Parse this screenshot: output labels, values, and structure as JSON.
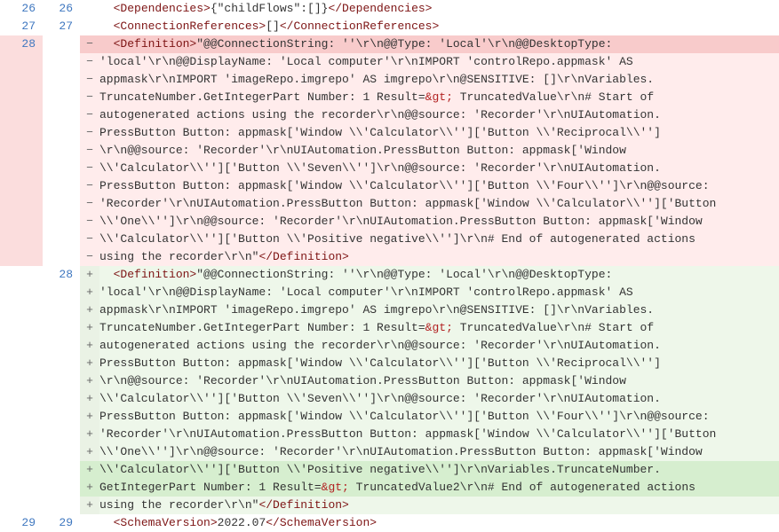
{
  "rows": [
    {
      "old": "26",
      "new": "26",
      "marker": "",
      "cls": "",
      "html": "  <span class='tag'>&lt;Dependencies&gt;</span>{\"childFlows\":[]}<span class='tag'>&lt;/Dependencies&gt;</span>"
    },
    {
      "old": "27",
      "new": "27",
      "marker": "",
      "cls": "",
      "html": "  <span class='tag'>&lt;ConnectionReferences&gt;</span>[]<span class='tag'>&lt;/ConnectionReferences&gt;</span>"
    },
    {
      "old": "28",
      "new": "",
      "marker": "−",
      "cls": "del del-hl",
      "html": "  <span class='tag'>&lt;Definition&gt;</span>\"@@ConnectionString: ''\\r\\n@@Type: 'Local'\\r\\n@@DesktopType: "
    },
    {
      "old": "",
      "new": "",
      "marker": "−",
      "cls": "del",
      "html": "'local'\\r\\n@@DisplayName: 'Local computer'\\r\\nIMPORT 'controlRepo.appmask' AS "
    },
    {
      "old": "",
      "new": "",
      "marker": "−",
      "cls": "del",
      "html": "appmask\\r\\nIMPORT 'imageRepo.imgrepo' AS imgrepo\\r\\n@SENSITIVE: []\\r\\nVariables."
    },
    {
      "old": "",
      "new": "",
      "marker": "−",
      "cls": "del",
      "html": "TruncateNumber.GetIntegerPart Number: 1 Result=<span class='red'>&amp;gt;</span> TruncatedValue\\r\\n# Start of "
    },
    {
      "old": "",
      "new": "",
      "marker": "−",
      "cls": "del",
      "html": "autogenerated actions using the recorder\\r\\n@@source: 'Recorder'\\r\\nUIAutomation."
    },
    {
      "old": "",
      "new": "",
      "marker": "−",
      "cls": "del",
      "html": "PressButton Button: appmask['Window \\\\'Calculator\\\\'']['Button \\\\'Reciprocal\\\\'']"
    },
    {
      "old": "",
      "new": "",
      "marker": "−",
      "cls": "del",
      "html": "\\r\\n@@source: 'Recorder'\\r\\nUIAutomation.PressButton Button: appmask['Window "
    },
    {
      "old": "",
      "new": "",
      "marker": "−",
      "cls": "del",
      "html": "\\\\'Calculator\\\\'']['Button \\\\'Seven\\\\'']\\r\\n@@source: 'Recorder'\\r\\nUIAutomation."
    },
    {
      "old": "",
      "new": "",
      "marker": "−",
      "cls": "del",
      "html": "PressButton Button: appmask['Window \\\\'Calculator\\\\'']['Button \\\\'Four\\\\'']\\r\\n@@source:"
    },
    {
      "old": "",
      "new": "",
      "marker": "−",
      "cls": "del",
      "html": "'Recorder'\\r\\nUIAutomation.PressButton Button: appmask['Window \\\\'Calculator\\\\'']['Button"
    },
    {
      "old": "",
      "new": "",
      "marker": "−",
      "cls": "del",
      "html": "\\\\'One\\\\'']\\r\\n@@source: 'Recorder'\\r\\nUIAutomation.PressButton Button: appmask['Window "
    },
    {
      "old": "",
      "new": "",
      "marker": "−",
      "cls": "del",
      "html": "\\\\'Calculator\\\\'']['Button \\\\'Positive negative\\\\'']\\r\\n# End of autogenerated actions "
    },
    {
      "old": "",
      "new": "",
      "marker": "−",
      "cls": "del",
      "html": "using the recorder\\r\\n\"<span class='tag'>&lt;/Definition&gt;</span>"
    },
    {
      "old": "",
      "new": "28",
      "marker": "+",
      "cls": "add",
      "html": "  <span class='tag'>&lt;Definition&gt;</span>\"@@ConnectionString: ''\\r\\n@@Type: 'Local'\\r\\n@@DesktopType: "
    },
    {
      "old": "",
      "new": "",
      "marker": "+",
      "cls": "add",
      "html": "'local'\\r\\n@@DisplayName: 'Local computer'\\r\\nIMPORT 'controlRepo.appmask' AS "
    },
    {
      "old": "",
      "new": "",
      "marker": "+",
      "cls": "add",
      "html": "appmask\\r\\nIMPORT 'imageRepo.imgrepo' AS imgrepo\\r\\n@SENSITIVE: []\\r\\nVariables."
    },
    {
      "old": "",
      "new": "",
      "marker": "+",
      "cls": "add",
      "html": "TruncateNumber.GetIntegerPart Number: 1 Result=<span class='red'>&amp;gt;</span> TruncatedValue\\r\\n# Start of "
    },
    {
      "old": "",
      "new": "",
      "marker": "+",
      "cls": "add",
      "html": "autogenerated actions using the recorder\\r\\n@@source: 'Recorder'\\r\\nUIAutomation."
    },
    {
      "old": "",
      "new": "",
      "marker": "+",
      "cls": "add",
      "html": "PressButton Button: appmask['Window \\\\'Calculator\\\\'']['Button \\\\'Reciprocal\\\\'']"
    },
    {
      "old": "",
      "new": "",
      "marker": "+",
      "cls": "add",
      "html": "\\r\\n@@source: 'Recorder'\\r\\nUIAutomation.PressButton Button: appmask['Window "
    },
    {
      "old": "",
      "new": "",
      "marker": "+",
      "cls": "add",
      "html": "\\\\'Calculator\\\\'']['Button \\\\'Seven\\\\'']\\r\\n@@source: 'Recorder'\\r\\nUIAutomation."
    },
    {
      "old": "",
      "new": "",
      "marker": "+",
      "cls": "add",
      "html": "PressButton Button: appmask['Window \\\\'Calculator\\\\'']['Button \\\\'Four\\\\'']\\r\\n@@source:"
    },
    {
      "old": "",
      "new": "",
      "marker": "+",
      "cls": "add",
      "html": "'Recorder'\\r\\nUIAutomation.PressButton Button: appmask['Window \\\\'Calculator\\\\'']['Button"
    },
    {
      "old": "",
      "new": "",
      "marker": "+",
      "cls": "add",
      "html": "\\\\'One\\\\'']\\r\\n@@source: 'Recorder'\\r\\nUIAutomation.PressButton Button: appmask['Window "
    },
    {
      "old": "",
      "new": "",
      "marker": "+",
      "cls": "add add-hl",
      "html": "\\\\'Calculator\\\\'']['Button \\\\'Positive negative\\\\'']\\r\\nVariables.TruncateNumber."
    },
    {
      "old": "",
      "new": "",
      "marker": "+",
      "cls": "add add-hl",
      "html": "GetIntegerPart Number: 1 Result=<span class='red'>&amp;gt;</span> TruncatedValue2\\r\\n# End of autogenerated actions"
    },
    {
      "old": "",
      "new": "",
      "marker": "+",
      "cls": "add",
      "html": "using the recorder\\r\\n\"<span class='tag'>&lt;/Definition&gt;</span>"
    },
    {
      "old": "29",
      "new": "29",
      "marker": "",
      "cls": "",
      "html": "  <span class='tag'>&lt;SchemaVersion&gt;</span>2022.07<span class='tag'>&lt;/SchemaVersion&gt;</span>"
    }
  ]
}
